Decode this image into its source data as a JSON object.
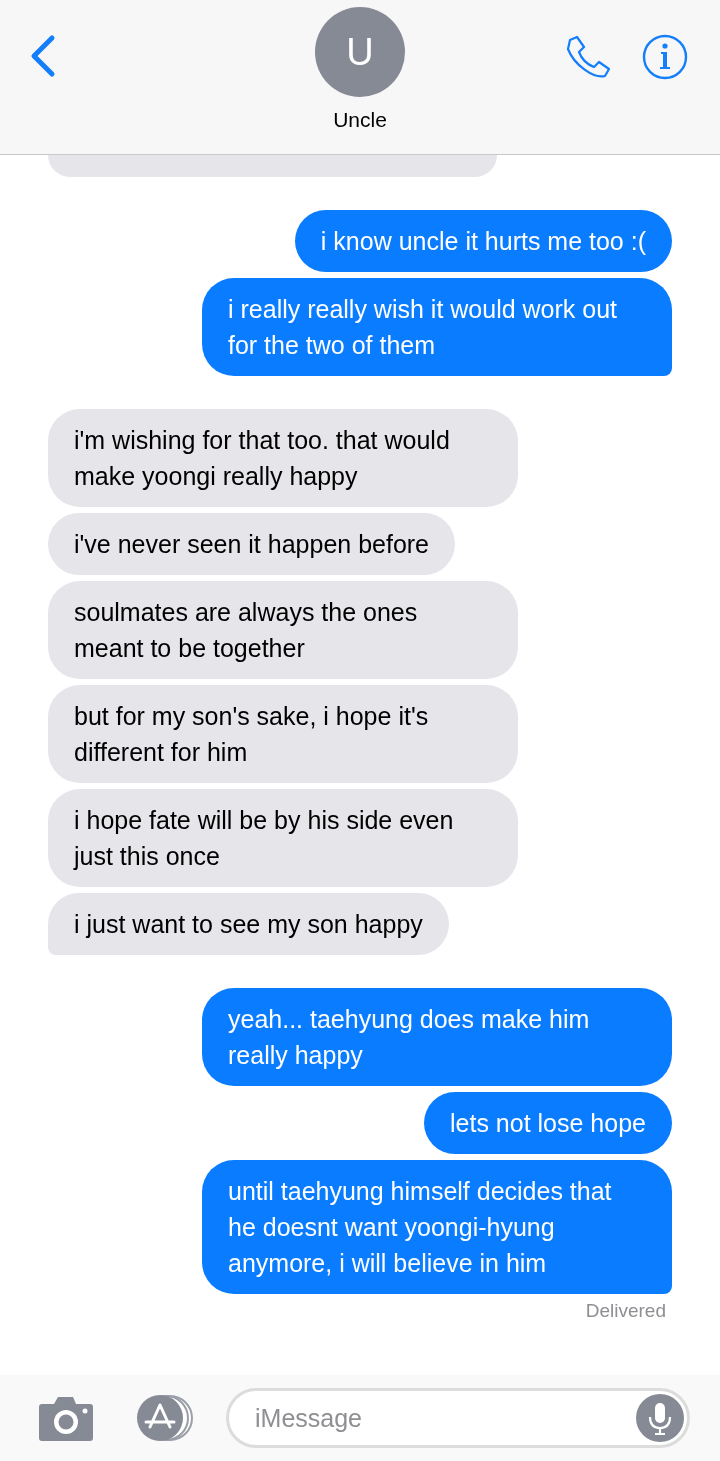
{
  "header": {
    "avatar_initial": "U",
    "contact_name": "Uncle"
  },
  "messages": [
    {
      "kind": "cut"
    },
    {
      "kind": "sent",
      "text": "i know uncle it hurts me too :("
    },
    {
      "kind": "sent",
      "text": "i really really wish it would work out for the two of them"
    },
    {
      "kind": "received",
      "text": "i'm wishing for that too. that would make yoongi really happy"
    },
    {
      "kind": "received",
      "text": "i've never seen it happen before"
    },
    {
      "kind": "received",
      "text": "soulmates are always the ones meant to be together"
    },
    {
      "kind": "received",
      "text": "but for my son's sake, i hope it's different for him"
    },
    {
      "kind": "received",
      "text": "i hope fate will be by his side even just this once"
    },
    {
      "kind": "received",
      "text": "i just want to see my son happy"
    },
    {
      "kind": "sent",
      "text": "yeah... taehyung does make him really happy"
    },
    {
      "kind": "sent",
      "text": "lets not lose hope"
    },
    {
      "kind": "sent",
      "text": "until taehyung himself decides that he doesnt want yoongi-hyung anymore, i will believe in him"
    }
  ],
  "status": "Delivered",
  "composer": {
    "placeholder": "iMessage"
  }
}
